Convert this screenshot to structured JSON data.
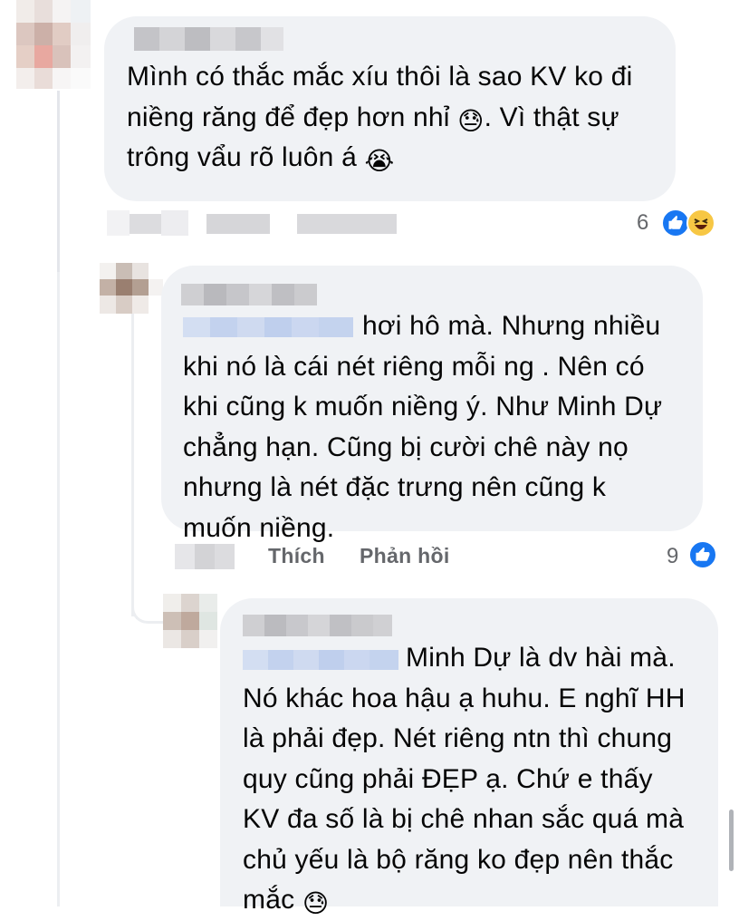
{
  "comments": [
    {
      "text": "Mình có thắc mắc xíu thôi là sao KV ko đi niềng răng để đẹp hơn nhỉ 😓. Vì thật sự trông vẩu rõ luôn á 😭",
      "line1": "Mình có thắc mắc xíu thôi là sao KV ko đi",
      "line2a": "niềng răng để đẹp hơn nhỉ",
      "line2b": ". Vì thật sự",
      "line3": "trông vẩu rõ luôn á",
      "reaction_count": "6",
      "reactions": [
        "like-icon",
        "haha-icon"
      ]
    },
    {
      "line1": "hơi hô mà. Nhưng nhiều",
      "line2": "khi nó là cái nét riêng mỗi ng . Nên có",
      "line3": "khi cũng k muốn niềng ý. Như Minh Dự",
      "line4": "chẳng hạn. Cũng bị cười chê này nọ",
      "line5": "nhưng là nét đặc trưng nên cũng k",
      "line6": "muốn niềng.",
      "like_label": "Thích",
      "reply_label": "Phản hồi",
      "reaction_count": "9",
      "reactions": [
        "like-icon"
      ]
    },
    {
      "line1": "Minh Dự là dv hài mà.",
      "line2": "Nó khác hoa hậu ạ huhu. E nghĩ HH",
      "line3": "là phải đẹp. Nét riêng ntn thì chung",
      "line4": "quy cũng phải ĐẸP ạ. Chứ e thấy",
      "line5": "KV đa số là bị chê nhan sắc quá mà",
      "line6": "chủ yếu là bộ răng ko đẹp nên thắc",
      "line7": "mắc"
    }
  ],
  "emojis": {
    "sad_sweat": "😓",
    "crying": "😭"
  },
  "colors": {
    "bubble": "#f0f2f5",
    "text": "#050505",
    "secondary": "#65676b",
    "like_blue": "#1877f2",
    "blur_gray": "#c9c9cc",
    "mention_blue": "#c7d6ef"
  }
}
